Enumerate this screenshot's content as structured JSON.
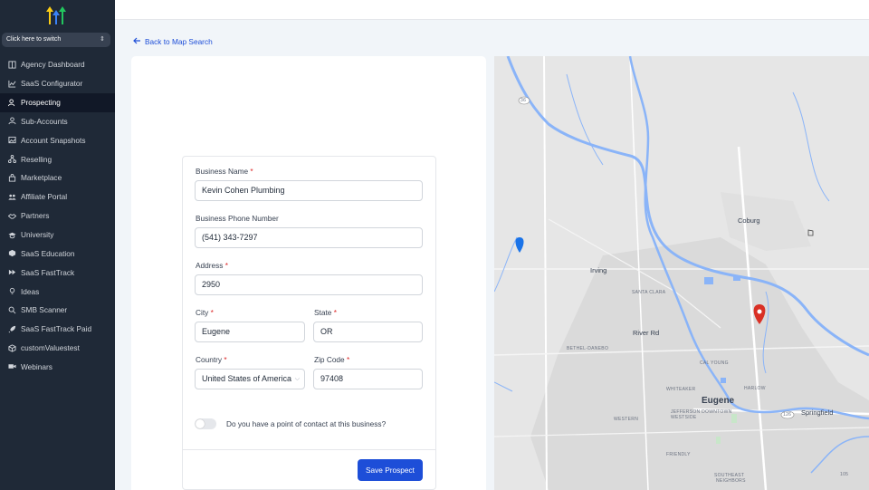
{
  "sidebar": {
    "switcher_label": "Click here to switch",
    "items": [
      {
        "label": "Agency Dashboard",
        "icon": "dashboard-icon"
      },
      {
        "label": "SaaS Configurator",
        "icon": "chart-icon"
      },
      {
        "label": "Prospecting",
        "icon": "user-search-icon",
        "active": true
      },
      {
        "label": "Sub-Accounts",
        "icon": "user-icon"
      },
      {
        "label": "Account Snapshots",
        "icon": "image-icon"
      },
      {
        "label": "Reselling",
        "icon": "hierarchy-icon"
      },
      {
        "label": "Marketplace",
        "icon": "bag-icon"
      },
      {
        "label": "Affiliate Portal",
        "icon": "users-icon"
      },
      {
        "label": "Partners",
        "icon": "handshake-icon"
      },
      {
        "label": "University",
        "icon": "graduation-icon"
      },
      {
        "label": "SaaS Education",
        "icon": "cube-icon"
      },
      {
        "label": "SaaS FastTrack",
        "icon": "fast-forward-icon"
      },
      {
        "label": "Ideas",
        "icon": "lightbulb-icon"
      },
      {
        "label": "SMB Scanner",
        "icon": "search-icon"
      },
      {
        "label": "SaaS FastTrack Paid",
        "icon": "rocket-icon"
      },
      {
        "label": "customValuestest",
        "icon": "box-icon"
      },
      {
        "label": "Webinars",
        "icon": "video-icon"
      }
    ]
  },
  "nav": {
    "back_label": "Back to Map Search"
  },
  "form": {
    "business_name": {
      "label": "Business Name",
      "value": "Kevin Cohen Plumbing"
    },
    "phone": {
      "label": "Business Phone Number",
      "value": "(541) 343-7297"
    },
    "address": {
      "label": "Address",
      "value": "2950"
    },
    "city": {
      "label": "City",
      "value": "Eugene"
    },
    "state": {
      "label": "State",
      "value": "OR"
    },
    "country": {
      "label": "Country",
      "value": "United States of America"
    },
    "zip": {
      "label": "Zip Code",
      "value": "97408"
    },
    "contact_toggle_label": "Do you have a point of contact at this business?",
    "save_label": "Save Prospect",
    "required_mark": "*"
  },
  "map": {
    "labels": {
      "coburg": "Coburg",
      "irving": "Irving",
      "santa_clara": "SANTA CLARA",
      "river_rd": "River Rd",
      "bethel": "BETHEL-DANEBO",
      "cal_young": "CAL YOUNG",
      "whiteaker": "WHITEAKER",
      "harlow": "HARLOW",
      "eugene": "Eugene",
      "springfield": "Springfield",
      "jefferson": "JEFFERSON DOWNTOWN",
      "westside": "WESTSIDE",
      "western": "WESTERN",
      "friendly": "FRIENDLY",
      "southeast": "SOUTHEAST",
      "neighbors": "NEIGHBORS",
      "shield_36": "36",
      "shield_126": "126",
      "shield_105": "105"
    },
    "colors": {
      "water": "#8ab4f8",
      "land": "#e6e6e6",
      "urban": "#dadada",
      "pin": "#d93025"
    }
  }
}
